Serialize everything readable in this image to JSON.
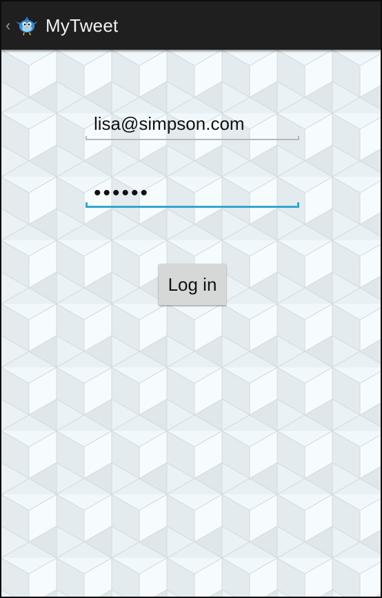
{
  "action_bar": {
    "title": "MyTweet",
    "up_icon": "chevron-left-icon",
    "app_icon": "bird-icon"
  },
  "login_form": {
    "email_value": "lisa@simpson.com",
    "password_masked": "••••••",
    "login_label": "Log in"
  },
  "colors": {
    "action_bar_bg": "#1f1f1f",
    "content_bg": "#eef7fb",
    "focus_accent": "#33a6cf",
    "button_bg": "#d6d7d7"
  }
}
